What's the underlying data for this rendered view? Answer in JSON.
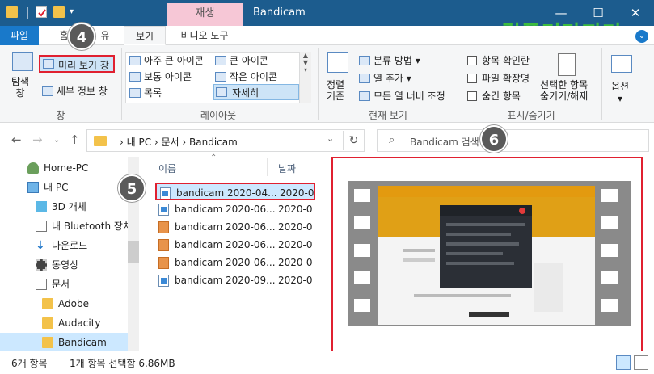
{
  "titlebar": {
    "context_tab": "재생",
    "title": "Bandicam",
    "minimize": "—",
    "maximize": "☐",
    "close": "✕"
  },
  "watermark": "컴퓨터마지기",
  "tabs": {
    "file": "파일",
    "home": "홈",
    "share": "유",
    "view": "보기",
    "video_tools": "비디오 도구"
  },
  "ribbon": {
    "pane_nav": "탐색\n창",
    "preview_pane": "미리 보기 창",
    "details_pane": "세부 정보 창",
    "group_panes": "창",
    "layouts": [
      "아주 큰 아이콘",
      "큰 아이콘",
      "보통 아이콘",
      "작은 아이콘",
      "목록",
      "자세히"
    ],
    "group_layout": "레이아웃",
    "sort_by": "정렬\n기준",
    "group_by": "분류 방법",
    "add_columns": "열 추가",
    "fit_columns": "모든 열 너비 조정",
    "group_current_view": "현재 보기",
    "item_checkboxes": "항목 확인란",
    "file_extensions": "파일 확장명",
    "hidden_items": "숨긴 항목",
    "hide_selected": "선택한 항목\n숨기기/해제",
    "group_show_hide": "표시/숨기기",
    "options": "옵션"
  },
  "badges": {
    "b4": "4",
    "b5": "5",
    "b6": "6"
  },
  "address": {
    "path": "›  내 PC  ›  문서  ›  Bandicam",
    "search_placeholder": "Bandicam 검색"
  },
  "nav": {
    "items": [
      {
        "label": "Home-PC"
      },
      {
        "label": "내 PC"
      },
      {
        "label": "3D 개체"
      },
      {
        "label": "내 Bluetooth 장치"
      },
      {
        "label": "다운로드"
      },
      {
        "label": "동영상"
      },
      {
        "label": "문서"
      },
      {
        "label": "Adobe"
      },
      {
        "label": "Audacity"
      },
      {
        "label": "Bandicam"
      }
    ]
  },
  "files": {
    "col_name": "이름",
    "col_date": "날짜",
    "rows": [
      {
        "name": "bandicam 2020-04...",
        "date": "2020-0",
        "type": "mp4"
      },
      {
        "name": "bandicam 2020-06...",
        "date": "2020-0",
        "type": "mp4"
      },
      {
        "name": "bandicam 2020-06...",
        "date": "2020-0",
        "type": "jpg"
      },
      {
        "name": "bandicam 2020-06...",
        "date": "2020-0",
        "type": "jpg"
      },
      {
        "name": "bandicam 2020-06...",
        "date": "2020-0",
        "type": "jpg"
      },
      {
        "name": "bandicam 2020-09...",
        "date": "2020-0",
        "type": "mp4"
      }
    ]
  },
  "status": {
    "count": "6개 항목",
    "selection": "1개 항목 선택함 6.86MB"
  },
  "colors": {
    "titlebar": "#1c5c8e",
    "accent": "#1979ca",
    "highlight": "#e02030",
    "selection": "#cce8ff"
  }
}
